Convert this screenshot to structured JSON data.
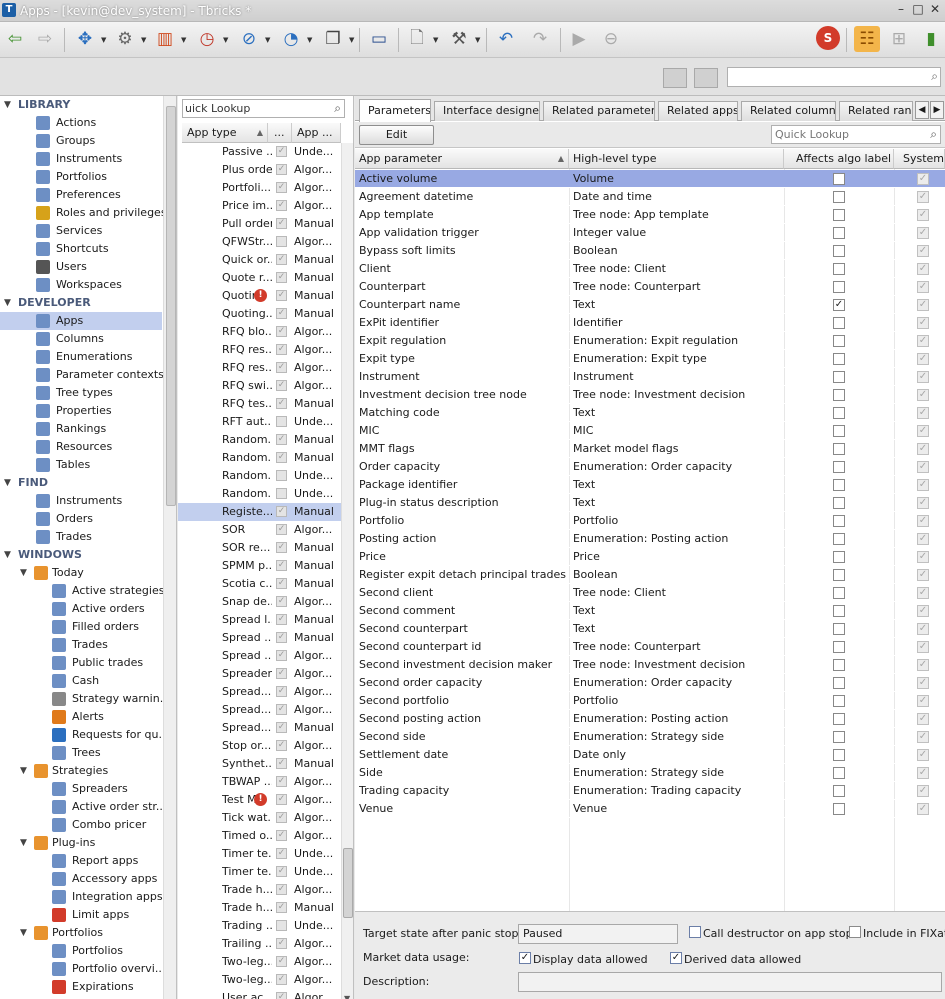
{
  "window": {
    "title": "Apps - [kevin@dev_system] - Tbricks *",
    "minimize": "–",
    "maximize": "□",
    "close": "✕"
  },
  "colors": {
    "accent": "#98a9e3",
    "selection": "#c2cfee",
    "warning": "#d23b2a"
  },
  "sidebar": {
    "nodes": [
      {
        "label": "LIBRARY",
        "kind": "head",
        "indent": 0,
        "icon": ""
      },
      {
        "label": "Actions",
        "kind": "item",
        "indent": 2,
        "icon": "actions-icon"
      },
      {
        "label": "Groups",
        "kind": "item",
        "indent": 2,
        "icon": "groups-icon"
      },
      {
        "label": "Instruments",
        "kind": "item",
        "indent": 2,
        "icon": "instruments-icon"
      },
      {
        "label": "Portfolios",
        "kind": "item",
        "indent": 2,
        "icon": "portfolios-icon"
      },
      {
        "label": "Preferences",
        "kind": "item",
        "indent": 2,
        "icon": "preferences-icon"
      },
      {
        "label": "Roles and privileges",
        "kind": "item",
        "indent": 2,
        "icon": "key-icon"
      },
      {
        "label": "Services",
        "kind": "item",
        "indent": 2,
        "icon": "services-icon"
      },
      {
        "label": "Shortcuts",
        "kind": "item",
        "indent": 2,
        "icon": "shortcuts-icon"
      },
      {
        "label": "Users",
        "kind": "item",
        "indent": 2,
        "icon": "user-icon"
      },
      {
        "label": "Workspaces",
        "kind": "item",
        "indent": 2,
        "icon": "workspaces-icon"
      },
      {
        "label": "DEVELOPER",
        "kind": "head",
        "indent": 0,
        "icon": ""
      },
      {
        "label": "Apps",
        "kind": "sel",
        "indent": 2,
        "icon": "apps-icon"
      },
      {
        "label": "Columns",
        "kind": "item",
        "indent": 2,
        "icon": "columns-icon"
      },
      {
        "label": "Enumerations",
        "kind": "item",
        "indent": 2,
        "icon": "enumerations-icon"
      },
      {
        "label": "Parameter contexts",
        "kind": "item",
        "indent": 2,
        "icon": "parameter-contexts-icon"
      },
      {
        "label": "Tree types",
        "kind": "item",
        "indent": 2,
        "icon": "tree-types-icon"
      },
      {
        "label": "Properties",
        "kind": "item",
        "indent": 2,
        "icon": "properties-icon"
      },
      {
        "label": "Rankings",
        "kind": "item",
        "indent": 2,
        "icon": "rankings-icon"
      },
      {
        "label": "Resources",
        "kind": "item",
        "indent": 2,
        "icon": "resources-icon"
      },
      {
        "label": "Tables",
        "kind": "item",
        "indent": 2,
        "icon": "tables-icon"
      },
      {
        "label": "FIND",
        "kind": "head",
        "indent": 0,
        "icon": ""
      },
      {
        "label": "Instruments",
        "kind": "item",
        "indent": 2,
        "icon": "instruments-icon"
      },
      {
        "label": "Orders",
        "kind": "item",
        "indent": 2,
        "icon": "orders-icon"
      },
      {
        "label": "Trades",
        "kind": "item",
        "indent": 2,
        "icon": "trades-icon"
      },
      {
        "label": "WINDOWS",
        "kind": "head",
        "indent": 0,
        "icon": ""
      },
      {
        "label": "Today",
        "kind": "folder",
        "indent": 1,
        "icon": "folder-icon"
      },
      {
        "label": "Active strategies",
        "kind": "item",
        "indent": 3,
        "icon": "strategy-icon"
      },
      {
        "label": "Active orders",
        "kind": "item",
        "indent": 3,
        "icon": "orders-icon"
      },
      {
        "label": "Filled orders",
        "kind": "item",
        "indent": 3,
        "icon": "orders-icon"
      },
      {
        "label": "Trades",
        "kind": "item",
        "indent": 3,
        "icon": "trades-icon"
      },
      {
        "label": "Public trades",
        "kind": "item",
        "indent": 3,
        "icon": "trades-icon"
      },
      {
        "label": "Cash",
        "kind": "item",
        "indent": 3,
        "icon": "cash-icon"
      },
      {
        "label": "Strategy warnin...",
        "kind": "item",
        "indent": 3,
        "icon": "warning-icon"
      },
      {
        "label": "Alerts",
        "kind": "item",
        "indent": 3,
        "icon": "alert-icon"
      },
      {
        "label": "Requests for qu...",
        "kind": "item",
        "indent": 3,
        "icon": "rfq-icon"
      },
      {
        "label": "Trees",
        "kind": "item",
        "indent": 3,
        "icon": "trees-icon"
      },
      {
        "label": "Strategies",
        "kind": "folder",
        "indent": 1,
        "icon": "folder-icon"
      },
      {
        "label": "Spreaders",
        "kind": "item",
        "indent": 3,
        "icon": "strategy-icon"
      },
      {
        "label": "Active order str...",
        "kind": "item",
        "indent": 3,
        "icon": "strategy-icon"
      },
      {
        "label": "Combo pricer",
        "kind": "item",
        "indent": 3,
        "icon": "strategy-icon"
      },
      {
        "label": "Plug-ins",
        "kind": "folder",
        "indent": 1,
        "icon": "folder-icon"
      },
      {
        "label": "Report apps",
        "kind": "item",
        "indent": 3,
        "icon": "plugin-icon"
      },
      {
        "label": "Accessory apps",
        "kind": "item",
        "indent": 3,
        "icon": "plugin-icon"
      },
      {
        "label": "Integration apps",
        "kind": "item",
        "indent": 3,
        "icon": "plugin-icon"
      },
      {
        "label": "Limit apps",
        "kind": "item",
        "indent": 3,
        "icon": "limit-icon"
      },
      {
        "label": "Portfolios",
        "kind": "folder",
        "indent": 1,
        "icon": "folder-icon"
      },
      {
        "label": "Portfolios",
        "kind": "item",
        "indent": 3,
        "icon": "portfolios-icon"
      },
      {
        "label": "Portfolio overvi...",
        "kind": "item",
        "indent": 3,
        "icon": "portfolios-icon"
      },
      {
        "label": "Expirations",
        "kind": "item",
        "indent": 3,
        "icon": "exp-icon"
      }
    ]
  },
  "apps_list": {
    "quick_lookup": "uick Lookup",
    "headers": {
      "type": "App type",
      "dots": "...",
      "app": "App ..."
    },
    "rows": [
      {
        "name": "Passive ...",
        "checked": true,
        "type": "Unde...",
        "warn": false,
        "sel": false
      },
      {
        "name": "Plus order",
        "checked": true,
        "type": "Algor...",
        "warn": false,
        "sel": false
      },
      {
        "name": "Portfoli...",
        "checked": true,
        "type": "Algor...",
        "warn": false,
        "sel": false
      },
      {
        "name": "Price im...",
        "checked": true,
        "type": "Algor...",
        "warn": false,
        "sel": false
      },
      {
        "name": "Pull order",
        "checked": true,
        "type": "Manual",
        "warn": false,
        "sel": false
      },
      {
        "name": "QFWStr...",
        "checked": false,
        "type": "Algor...",
        "warn": false,
        "sel": false
      },
      {
        "name": "Quick or...",
        "checked": true,
        "type": "Manual",
        "warn": false,
        "sel": false
      },
      {
        "name": "Quote r...",
        "checked": true,
        "type": "Manual",
        "warn": false,
        "sel": false
      },
      {
        "name": "Quotin",
        "checked": true,
        "type": "Manual",
        "warn": true,
        "sel": false
      },
      {
        "name": "Quoting...",
        "checked": true,
        "type": "Manual",
        "warn": false,
        "sel": false
      },
      {
        "name": "RFQ blo...",
        "checked": true,
        "type": "Algor...",
        "warn": false,
        "sel": false
      },
      {
        "name": "RFQ res...",
        "checked": true,
        "type": "Algor...",
        "warn": false,
        "sel": false
      },
      {
        "name": "RFQ res...",
        "checked": true,
        "type": "Algor...",
        "warn": false,
        "sel": false
      },
      {
        "name": "RFQ swi...",
        "checked": true,
        "type": "Algor...",
        "warn": false,
        "sel": false
      },
      {
        "name": "RFQ tes...",
        "checked": true,
        "type": "Manual",
        "warn": false,
        "sel": false
      },
      {
        "name": "RFT aut...",
        "checked": false,
        "type": "Unde...",
        "warn": false,
        "sel": false
      },
      {
        "name": "Random...",
        "checked": true,
        "type": "Manual",
        "warn": false,
        "sel": false
      },
      {
        "name": "Random...",
        "checked": true,
        "type": "Manual",
        "warn": false,
        "sel": false
      },
      {
        "name": "Random...",
        "checked": false,
        "type": "Unde...",
        "warn": false,
        "sel": false
      },
      {
        "name": "Random...",
        "checked": false,
        "type": "Unde...",
        "warn": false,
        "sel": false
      },
      {
        "name": "Registe...",
        "checked": true,
        "type": "Manual",
        "warn": false,
        "sel": true
      },
      {
        "name": "SOR",
        "checked": true,
        "type": "Algor...",
        "warn": false,
        "sel": false
      },
      {
        "name": "SOR re...",
        "checked": true,
        "type": "Manual",
        "warn": false,
        "sel": false
      },
      {
        "name": "SPMM p...",
        "checked": true,
        "type": "Manual",
        "warn": false,
        "sel": false
      },
      {
        "name": "Scotia c...",
        "checked": true,
        "type": "Manual",
        "warn": false,
        "sel": false
      },
      {
        "name": "Snap de...",
        "checked": true,
        "type": "Algor...",
        "warn": false,
        "sel": false
      },
      {
        "name": "Spread l...",
        "checked": true,
        "type": "Manual",
        "warn": false,
        "sel": false
      },
      {
        "name": "Spread ...",
        "checked": true,
        "type": "Manual",
        "warn": false,
        "sel": false
      },
      {
        "name": "Spread ...",
        "checked": true,
        "type": "Algor...",
        "warn": false,
        "sel": false
      },
      {
        "name": "Spreader",
        "checked": true,
        "type": "Algor...",
        "warn": false,
        "sel": false
      },
      {
        "name": "Spread...",
        "checked": true,
        "type": "Algor...",
        "warn": false,
        "sel": false
      },
      {
        "name": "Spread...",
        "checked": true,
        "type": "Algor...",
        "warn": false,
        "sel": false
      },
      {
        "name": "Spread...",
        "checked": true,
        "type": "Manual",
        "warn": false,
        "sel": false
      },
      {
        "name": "Stop or...",
        "checked": true,
        "type": "Algor...",
        "warn": false,
        "sel": false
      },
      {
        "name": "Synthet...",
        "checked": true,
        "type": "Manual",
        "warn": false,
        "sel": false
      },
      {
        "name": "TBWAP ...",
        "checked": true,
        "type": "Algor...",
        "warn": false,
        "sel": false
      },
      {
        "name": "Test M",
        "checked": true,
        "type": "Algor...",
        "warn": true,
        "sel": false
      },
      {
        "name": "Tick wat...",
        "checked": true,
        "type": "Algor...",
        "warn": false,
        "sel": false
      },
      {
        "name": "Timed o...",
        "checked": true,
        "type": "Algor...",
        "warn": false,
        "sel": false
      },
      {
        "name": "Timer te...",
        "checked": true,
        "type": "Unde...",
        "warn": false,
        "sel": false
      },
      {
        "name": "Timer te...",
        "checked": true,
        "type": "Unde...",
        "warn": false,
        "sel": false
      },
      {
        "name": "Trade h...",
        "checked": true,
        "type": "Algor...",
        "warn": false,
        "sel": false
      },
      {
        "name": "Trade h...",
        "checked": true,
        "type": "Manual",
        "warn": false,
        "sel": false
      },
      {
        "name": "Trading ...",
        "checked": false,
        "type": "Unde...",
        "warn": false,
        "sel": false
      },
      {
        "name": "Trailing ...",
        "checked": true,
        "type": "Algor...",
        "warn": false,
        "sel": false
      },
      {
        "name": "Two-leg...",
        "checked": true,
        "type": "Algor...",
        "warn": false,
        "sel": false
      },
      {
        "name": "Two-leg...",
        "checked": true,
        "type": "Algor...",
        "warn": false,
        "sel": false
      },
      {
        "name": "User ac...",
        "checked": true,
        "type": "Algor...",
        "warn": false,
        "sel": false
      }
    ]
  },
  "tabs": [
    "Parameters",
    "Interface designer",
    "Related parameters",
    "Related apps",
    "Related columns",
    "Related rank"
  ],
  "edit_button": "Edit",
  "quick_lookup": "Quick Lookup",
  "grid": {
    "headers": {
      "param": "App parameter",
      "type": "High-level type",
      "algo": "Affects algo label",
      "system": "System"
    },
    "rows": [
      {
        "p": "Active volume",
        "h": "Volume",
        "algo": false,
        "sel": true
      },
      {
        "p": "Agreement datetime",
        "h": "Date and time",
        "algo": false,
        "sel": false
      },
      {
        "p": "App template",
        "h": "Tree node: App template",
        "algo": false,
        "sel": false
      },
      {
        "p": "App validation trigger",
        "h": "Integer value",
        "algo": false,
        "sel": false
      },
      {
        "p": "Bypass soft limits",
        "h": "Boolean",
        "algo": false,
        "sel": false
      },
      {
        "p": "Client",
        "h": "Tree node: Client",
        "algo": false,
        "sel": false
      },
      {
        "p": "Counterpart",
        "h": "Tree node: Counterpart",
        "algo": false,
        "sel": false
      },
      {
        "p": "Counterpart name",
        "h": "Text",
        "algo": true,
        "sel": false
      },
      {
        "p": "ExPit identifier",
        "h": "Identifier",
        "algo": false,
        "sel": false
      },
      {
        "p": "Expit regulation",
        "h": "Enumeration: Expit regulation",
        "algo": false,
        "sel": false
      },
      {
        "p": "Expit type",
        "h": "Enumeration: Expit type",
        "algo": false,
        "sel": false
      },
      {
        "p": "Instrument",
        "h": "Instrument",
        "algo": false,
        "sel": false
      },
      {
        "p": "Investment decision tree node",
        "h": "Tree node: Investment decision",
        "algo": false,
        "sel": false
      },
      {
        "p": "Matching code",
        "h": "Text",
        "algo": false,
        "sel": false
      },
      {
        "p": "MIC",
        "h": "MIC",
        "algo": false,
        "sel": false
      },
      {
        "p": "MMT flags",
        "h": "Market model flags",
        "algo": false,
        "sel": false
      },
      {
        "p": "Order capacity",
        "h": "Enumeration: Order capacity",
        "algo": false,
        "sel": false
      },
      {
        "p": "Package identifier",
        "h": "Text",
        "algo": false,
        "sel": false
      },
      {
        "p": "Plug-in status description",
        "h": "Text",
        "algo": false,
        "sel": false
      },
      {
        "p": "Portfolio",
        "h": "Portfolio",
        "algo": false,
        "sel": false
      },
      {
        "p": "Posting action",
        "h": "Enumeration: Posting action",
        "algo": false,
        "sel": false
      },
      {
        "p": "Price",
        "h": "Price",
        "algo": false,
        "sel": false
      },
      {
        "p": "Register expit detach principal trades",
        "h": "Boolean",
        "algo": false,
        "sel": false
      },
      {
        "p": "Second client",
        "h": "Tree node: Client",
        "algo": false,
        "sel": false
      },
      {
        "p": "Second comment",
        "h": "Text",
        "algo": false,
        "sel": false
      },
      {
        "p": "Second counterpart",
        "h": "Text",
        "algo": false,
        "sel": false
      },
      {
        "p": "Second counterpart id",
        "h": "Tree node: Counterpart",
        "algo": false,
        "sel": false
      },
      {
        "p": "Second investment decision maker",
        "h": "Tree node: Investment decision",
        "algo": false,
        "sel": false
      },
      {
        "p": "Second order capacity",
        "h": "Enumeration: Order capacity",
        "algo": false,
        "sel": false
      },
      {
        "p": "Second portfolio",
        "h": "Portfolio",
        "algo": false,
        "sel": false
      },
      {
        "p": "Second posting action",
        "h": "Enumeration: Posting action",
        "algo": false,
        "sel": false
      },
      {
        "p": "Second side",
        "h": "Enumeration: Strategy side",
        "algo": false,
        "sel": false
      },
      {
        "p": "Settlement date",
        "h": "Date only",
        "algo": false,
        "sel": false
      },
      {
        "p": "Side",
        "h": "Enumeration: Strategy side",
        "algo": false,
        "sel": false
      },
      {
        "p": "Trading capacity",
        "h": "Enumeration: Trading capacity",
        "algo": false,
        "sel": false
      },
      {
        "p": "Venue",
        "h": "Venue",
        "algo": false,
        "sel": false
      }
    ]
  },
  "bottom": {
    "panic_label": "Target state after panic stop:",
    "panic_value": "Paused",
    "destructor_label": "Call destructor on app stop",
    "destructor_checked": false,
    "fix_label": "Include in FIXatdl",
    "fix_checked": false,
    "market_label": "Market data usage:",
    "display_label": "Display data allowed",
    "display_checked": true,
    "derived_label": "Derived data allowed",
    "derived_checked": true,
    "desc_label": "Description:",
    "desc_value": ""
  }
}
